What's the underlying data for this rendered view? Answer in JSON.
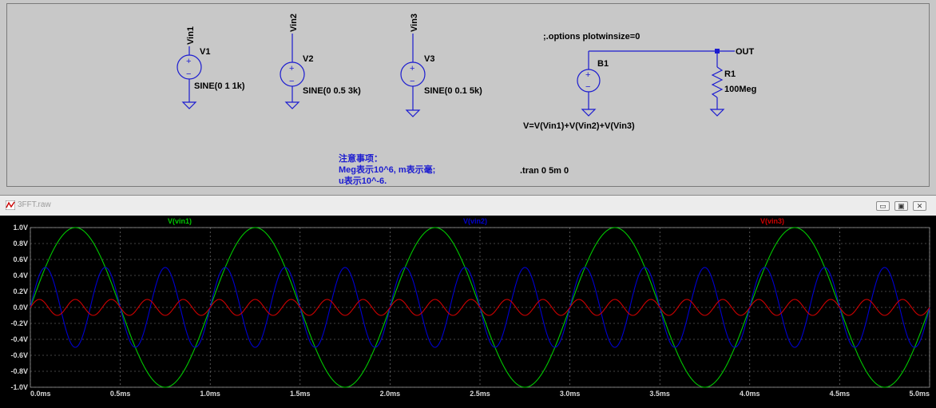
{
  "schematic": {
    "sources": [
      {
        "net": "Vin1",
        "name": "V1",
        "value": "SINE(0 1 1k)"
      },
      {
        "net": "Vin2",
        "name": "V2",
        "value": "SINE(0 0.5 3k)"
      },
      {
        "net": "Vin3",
        "name": "V3",
        "value": "SINE(0 0.1 5k)"
      }
    ],
    "options_directive": ";.options plotwinsize=0",
    "bsource": {
      "name": "B1",
      "expression": "V=V(Vin1)+V(Vin2)+V(Vin3)"
    },
    "out_label": "OUT",
    "resistor": {
      "name": "R1",
      "value": "100Meg"
    },
    "note": {
      "line1": "注意事项：",
      "line2": "Meg表示10^6, m表示毫;",
      "line3": "u表示10^-6."
    },
    "tran_directive": ".tran 0 5m 0"
  },
  "plot_window": {
    "title": "3FFT.raw",
    "buttons": {
      "minimize": "▭",
      "restore": "▣",
      "close": "✕"
    }
  },
  "chart_data": {
    "type": "line",
    "traces": [
      {
        "name": "V(vin1)",
        "color": "#00c800",
        "amplitude": 1.0,
        "frequency_hz": 1000
      },
      {
        "name": "V(vin2)",
        "color": "#0000d0",
        "amplitude": 0.5,
        "frequency_hz": 3000
      },
      {
        "name": "V(vin3)",
        "color": "#d00000",
        "amplitude": 0.1,
        "frequency_hz": 5000
      }
    ],
    "xlim": [
      0,
      5
    ],
    "x_unit": "ms",
    "ylim": [
      -1.0,
      1.0
    ],
    "x_ticks": [
      "0.0ms",
      "0.5ms",
      "1.0ms",
      "1.5ms",
      "2.0ms",
      "2.5ms",
      "3.0ms",
      "3.5ms",
      "4.0ms",
      "4.5ms",
      "5.0ms"
    ],
    "y_ticks": [
      "1.0V",
      "0.8V",
      "0.6V",
      "0.4V",
      "0.2V",
      "0.0V",
      "-0.2V",
      "-0.4V",
      "-0.6V",
      "-0.8V",
      "-1.0V"
    ],
    "grid": true,
    "background": "#000000"
  }
}
